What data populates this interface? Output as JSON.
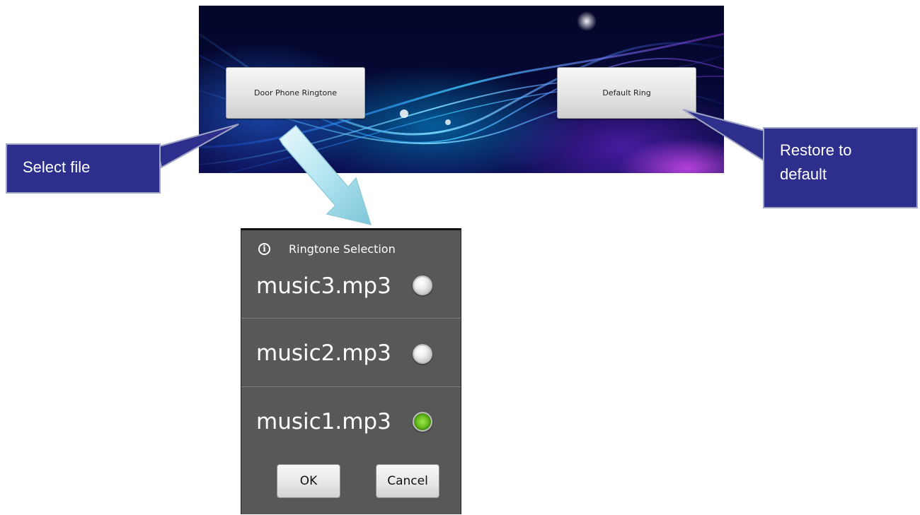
{
  "banner": {
    "door_phone_button": "Door Phone Ringtone",
    "default_ring_button": "Default Ring"
  },
  "callouts": {
    "select_file": "Select file",
    "restore_line1": "Restore to",
    "restore_line2": "default"
  },
  "dialog": {
    "title": "Ringtone Selection",
    "icon": "info-icon",
    "options": [
      {
        "label": "music3.mp3",
        "checked": false
      },
      {
        "label": "music2.mp3",
        "checked": false
      },
      {
        "label": "music1.mp3",
        "checked": true
      }
    ],
    "ok_label": "OK",
    "cancel_label": "Cancel"
  },
  "colors": {
    "callout_bg": "#2e2e8c",
    "dialog_bg": "#585858",
    "radio_checked": "#6cc020",
    "arrow": "#aee3ef"
  }
}
